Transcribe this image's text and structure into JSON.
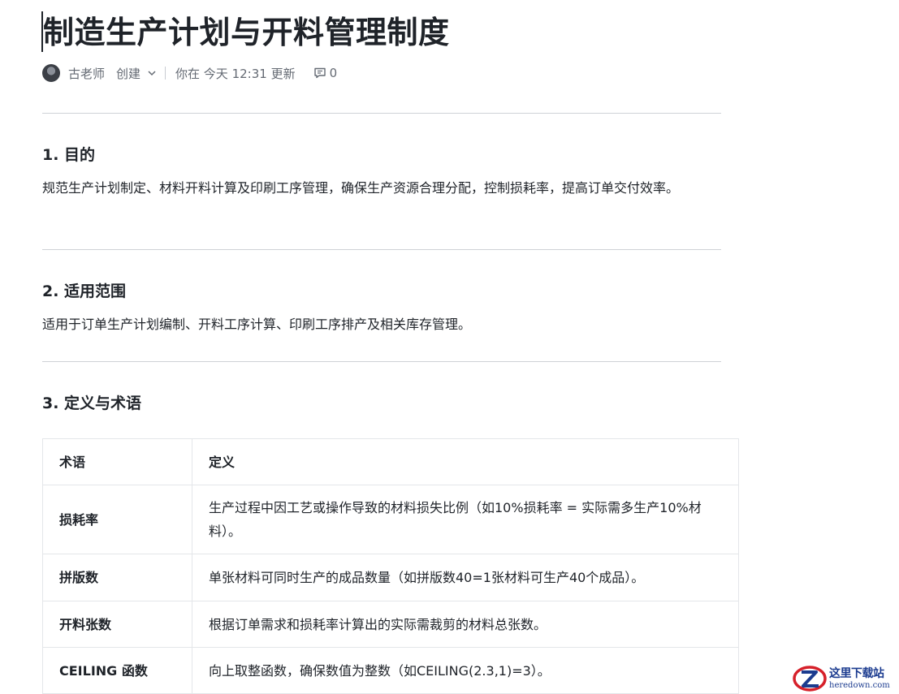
{
  "doc": {
    "title": "制造生产计划与开料管理制度",
    "author": "古老师",
    "created_label": "创建",
    "updated_text": "你在 今天 12:31 更新",
    "comment_count": "0"
  },
  "sections": [
    {
      "heading": "1. 目的",
      "body": "规范生产计划制定、材料开料计算及印刷工序管理，确保生产资源合理分配，控制损耗率，提高订单交付效率。"
    },
    {
      "heading": "2. 适用范围",
      "body": "适用于订单生产计划编制、开料工序计算、印刷工序排产及相关库存管理。"
    },
    {
      "heading": "3. 定义与术语"
    }
  ],
  "table": {
    "headers": [
      "术语",
      "定义"
    ],
    "rows": [
      {
        "term": "损耗率",
        "definition": "生产过程中因工艺或操作导致的材料损失比例（如10%损耗率 = 实际需多生产10%材料）。"
      },
      {
        "term": "拼版数",
        "definition": "单张材料可同时生产的成品数量（如拼版数40=1张材料可生产40个成品）。"
      },
      {
        "term": "开料张数",
        "definition": "根据订单需求和损耗率计算出的实际需裁剪的材料总张数。"
      },
      {
        "term": "CEILING 函数",
        "definition": "向上取整函数，确保数值为整数（如CEILING(2.3,1)=3）。"
      }
    ]
  },
  "watermark": {
    "cn": "这里下载站",
    "en": "heredown.com"
  },
  "colors": {
    "text": "#1f2329",
    "muted": "#646a73",
    "divider": "#cfd2d6",
    "watermark_blue": "#1b3b8f",
    "watermark_red": "#d6202a"
  }
}
